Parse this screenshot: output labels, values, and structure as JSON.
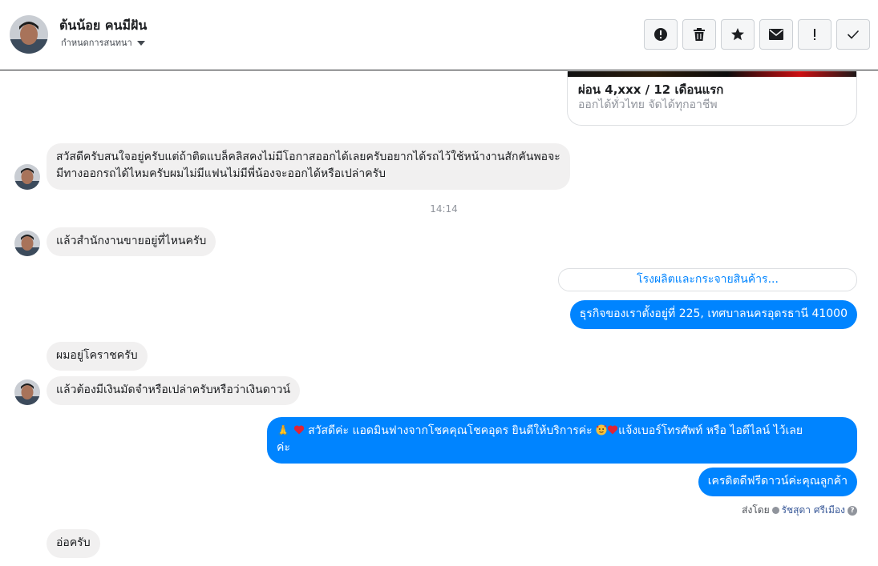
{
  "header": {
    "contact_name": "ต้นน้อย คนมีฝัน",
    "assign_label": "กำหนดการสนทนา",
    "actions": [
      {
        "icon": "alert-circle-icon"
      },
      {
        "icon": "trash-icon"
      },
      {
        "icon": "star-icon"
      },
      {
        "icon": "envelope-icon"
      },
      {
        "icon": "exclamation-icon"
      },
      {
        "icon": "check-icon"
      }
    ]
  },
  "card": {
    "title": "ผ่อน 4,xxx / 12 เดือนแรก",
    "subtitle": "ออกได้ทั่วไทย จัดได้ทุกอาชีพ"
  },
  "messages": {
    "m1_line1": "สวัสดีครับสนใจอยู่ครับแต่ถ้าติดแบล็คลิสคงไม่มีโอกาสออกได้เลยครับอยากได้รถไว้ใช้หน้างานสักคันพอจะ",
    "m1_line2": "มีทางออกรถได้ไหมครับผมไม่มีแฟนไม่มีพี่น้องจะออกได้หรือเปล่าครับ",
    "timestamp": "14:14",
    "m2": "แล้วสำนักงานขายอยู่ที่ไหนครับ",
    "link_label": "โรงผลิตและกระจายสินค้าร...",
    "m3": "ธุรกิจของเราตั้งอยู่ที่ 225, เทศบาลนครอุดรธานี 41000",
    "m4": "ผมอยู่โคราชครับ",
    "m5": "แล้วต้องมีเงินมัดจำหรือเปล่าครับหรือว่าเงินดาวน์",
    "m6_line1_a": " สวัสดีค่ะ แอดมินฟางจากโชคคุณโชคอุดร ยินดีให้บริการค่ะ",
    "m6_line1_b": "แจ้งเบอร์โทรศัพท์ หรือ ไอดีไลน์  ไว้เลย",
    "m6_line2": "ค่ะ",
    "m7": "เครดิตดีฟรีดาวน์ค่ะคุณลูกค้า",
    "sent_by_label": "ส่งโดย",
    "sent_by_name": "รัชสุดา ศรีเมือง",
    "m8": "อ่อครับ"
  },
  "colors": {
    "outgoing": "#0084ff",
    "incoming": "#f1f0f0",
    "link": "#0084ff"
  }
}
